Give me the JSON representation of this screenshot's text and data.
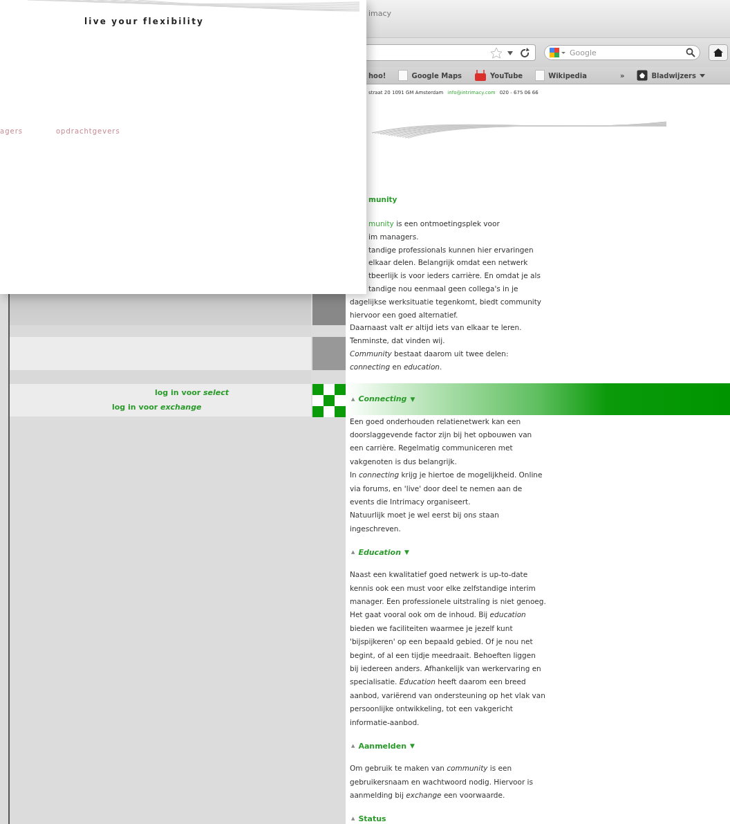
{
  "top_left_window": {
    "tagline": "live your flexibility",
    "nav": [
      "agers",
      "opdrachtgevers"
    ]
  },
  "browser": {
    "tab_title": "imacy",
    "search": {
      "placeholder": "Google"
    },
    "bookmarks": [
      {
        "label": "hoo!",
        "kind": "text"
      },
      {
        "label": "Google Maps",
        "kind": "page"
      },
      {
        "label": "YouTube",
        "kind": "video"
      },
      {
        "label": "Wikipedia",
        "kind": "page"
      },
      {
        "label": "»",
        "kind": "more"
      },
      {
        "label": "Bladwijzers",
        "kind": "folder"
      }
    ]
  },
  "page": {
    "contact": {
      "address": "straat 20  1091 GM  Amsterdam",
      "email": "info@intrimacy.com",
      "phone": "020 - 675 06 66"
    },
    "title": "munity",
    "intro_link": "munity",
    "intro_lines": [
      " is een ontmoetingsplek voor",
      "im managers.",
      "tandige professionals kunnen hier ervaringen",
      "elkaar delen. Belangrijk omdat een netwerk",
      "tbeerlijk is voor ieders carrière. En omdat je als",
      "tandige nou eenmaal geen collega's in je"
    ],
    "lines": [
      "dagelijkse werksituatie tegenkomt, biedt community",
      "hiervoor een goed alternatief.",
      "Daarnaast valt *er* altijd iets van elkaar te leren.",
      "Tenminste, dat vinden wij.",
      "*Community* bestaat daarom uit twee delen:",
      "*connecting* en *education*."
    ],
    "sections": [
      {
        "up": "▲",
        "label": "Connecting",
        "italic": true,
        "down": "▼",
        "band": true,
        "lines": [
          "Een goed onderhouden relatienetwerk kan een",
          "doorslaggevende factor zijn bij het opbouwen van",
          "een carrière. Regelmatig communiceren met",
          "vakgenoten is dus belangrijk.",
          "In *connecting* krijg je hiertoe de mogelijkheid. Online",
          "via forums, en 'live' door deel te nemen aan de",
          "events die Intrimacy organiseert.",
          "Natuurlijk moet je wel eerst bij ons staan",
          "ingeschreven."
        ]
      },
      {
        "up": "▲",
        "label": "Education",
        "italic": true,
        "down": "▼",
        "band": false,
        "lines": [
          "Naast een kwalitatief goed netwerk is up-to-date",
          "kennis ook een must voor elke zelfstandige interim",
          "manager. Een professionele uitstraling is niet genoeg.",
          "Het gaat vooral ook om de inhoud. Bij *education*",
          "bieden we faciliteiten waarmee je jezelf kunt",
          "'bijspijkeren' op een bepaald gebied. Of je nou net",
          "begint, of al een tijdje meedraait. Behoeften liggen",
          "bij iedereen anders. Afhankelijk van werkervaring en",
          "specialisatie. *Education* heeft daarom een breed",
          "aanbod, variërend van ondersteuning op het vlak van",
          "persoonlijke ontwikkeling, tot een vakgericht",
          "informatie-aanbod."
        ]
      },
      {
        "up": "▲",
        "label": "Aanmelden",
        "italic": false,
        "down": "▼",
        "band": false,
        "lines": [
          "Om gebruik te maken van *community* is een",
          "gebruikersnaam en wachtwoord nodig. Hiervoor is",
          "aanmelding bij *exchange* een voorwaarde."
        ]
      },
      {
        "up": "▲",
        "label": "Status",
        "italic": false,
        "band": false
      }
    ]
  },
  "sidebar": {
    "links": [
      "log in voor *select*",
      "log in voor *exchange*"
    ]
  }
}
